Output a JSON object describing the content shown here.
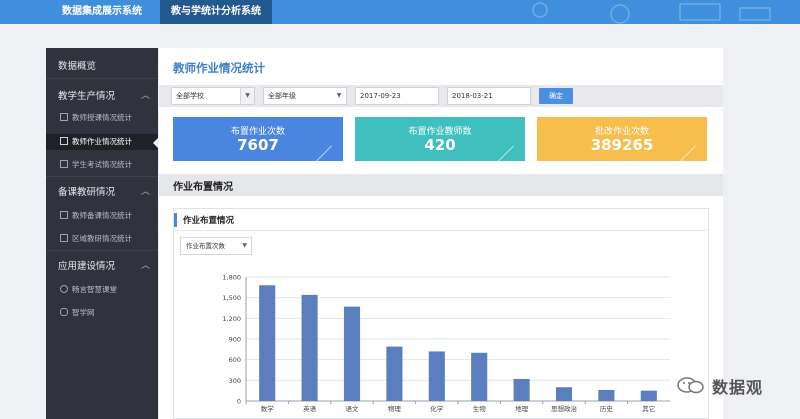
{
  "topnav": {
    "tabs": [
      {
        "label": "数据集成展示系统"
      },
      {
        "label": "教与学统计分析系统"
      }
    ]
  },
  "sidebar": {
    "overview": "数据概览",
    "sections": [
      {
        "label": "教学生产情况",
        "items": [
          "教师授课情况统计",
          "教师作业情况统计",
          "学生考试情况统计"
        ]
      },
      {
        "label": "备课教研情况",
        "items": [
          "教师备课情况统计",
          "区域教研情况统计"
        ]
      },
      {
        "label": "应用建设情况",
        "items": [
          "畅言智慧课堂",
          "智学网"
        ]
      }
    ],
    "active_item": "教师作业情况统计"
  },
  "main": {
    "title": "教师作业情况统计",
    "filters": {
      "school": "全部学校",
      "grade": "全部年级",
      "date_from": "2017-09-23",
      "date_to": "2018-03-21",
      "confirm": "确定"
    },
    "cards": [
      {
        "label": "布置作业次数",
        "value": "7607",
        "color": "#4a86e0"
      },
      {
        "label": "布置作业教师数",
        "value": "420",
        "color": "#3fc0bf"
      },
      {
        "label": "批改作业次数",
        "value": "389265",
        "color": "#f7be4e"
      }
    ],
    "section_title": "作业布置情况",
    "panel": {
      "title": "作业布置情况",
      "metric": "作业布置次数"
    }
  },
  "chart_data": {
    "type": "bar",
    "categories": [
      "数学",
      "英语",
      "语文",
      "物理",
      "化学",
      "生物",
      "地理",
      "思想政治",
      "历史",
      "其它"
    ],
    "values": [
      1680,
      1540,
      1370,
      790,
      720,
      700,
      320,
      200,
      160,
      150
    ],
    "ylim": [
      0,
      1800
    ],
    "yticks": [
      "0",
      "300",
      "600",
      "900",
      "1,200",
      "1,500",
      "1,800"
    ],
    "ytick_values": [
      0,
      300,
      600,
      900,
      1200,
      1500,
      1800
    ],
    "bar_color": "#5b7fbe",
    "grid": true
  },
  "watermark": {
    "text": "数据观"
  }
}
